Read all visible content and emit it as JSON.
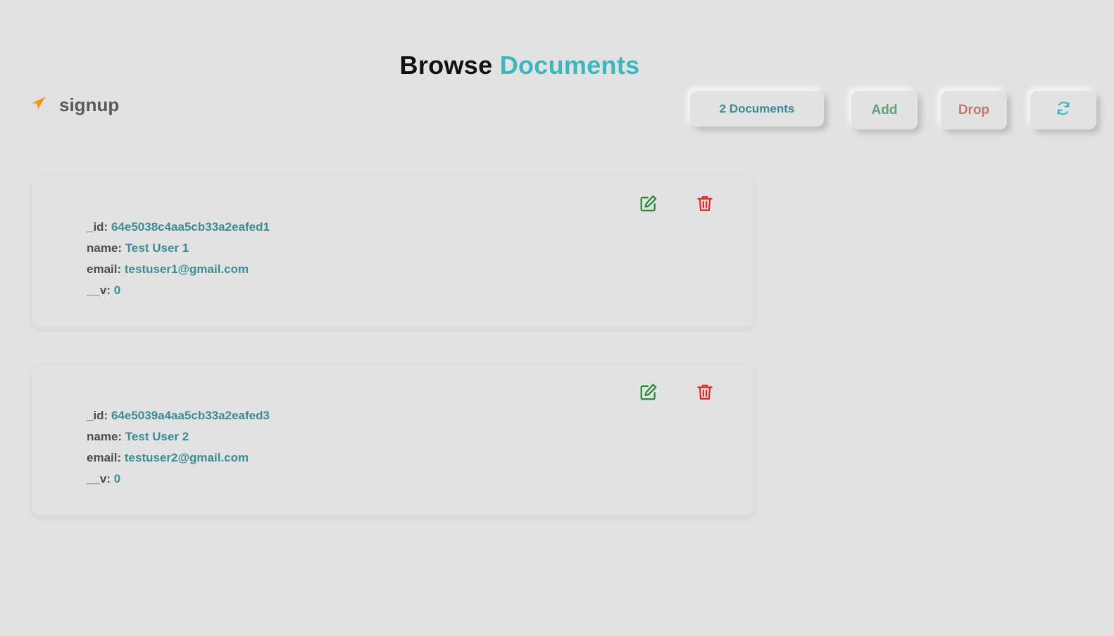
{
  "header": {
    "title_word1": "Browse",
    "title_word2": "Documents",
    "accent_color": "#3ab8bd"
  },
  "collection": {
    "icon": "paper-plane-icon",
    "icon_color": "#f59f22",
    "name": "signup"
  },
  "toolbar": {
    "count_label": "2 Documents",
    "add_label": "Add",
    "drop_label": "Drop",
    "refresh_icon": "refresh-icon"
  },
  "documents": [
    {
      "fields": [
        {
          "key": "_id:",
          "value": "64e5038c4aa5cb33a2eafed1"
        },
        {
          "key": "name:",
          "value": "Test User 1"
        },
        {
          "key": "email:",
          "value": "testuser1@gmail.com"
        },
        {
          "key": "__v:",
          "value": "0"
        }
      ],
      "edit_icon": "edit-icon",
      "delete_icon": "trash-icon"
    },
    {
      "fields": [
        {
          "key": "_id:",
          "value": "64e5039a4aa5cb33a2eafed3"
        },
        {
          "key": "name:",
          "value": "Test User 2"
        },
        {
          "key": "email:",
          "value": "testuser2@gmail.com"
        },
        {
          "key": "__v:",
          "value": "0"
        }
      ],
      "edit_icon": "edit-icon",
      "delete_icon": "trash-icon"
    }
  ],
  "colors": {
    "key_text": "#4d4d4d",
    "value_text": "#3a8d96",
    "edit_icon": "#1e8a2e",
    "delete_icon": "#e02424"
  }
}
